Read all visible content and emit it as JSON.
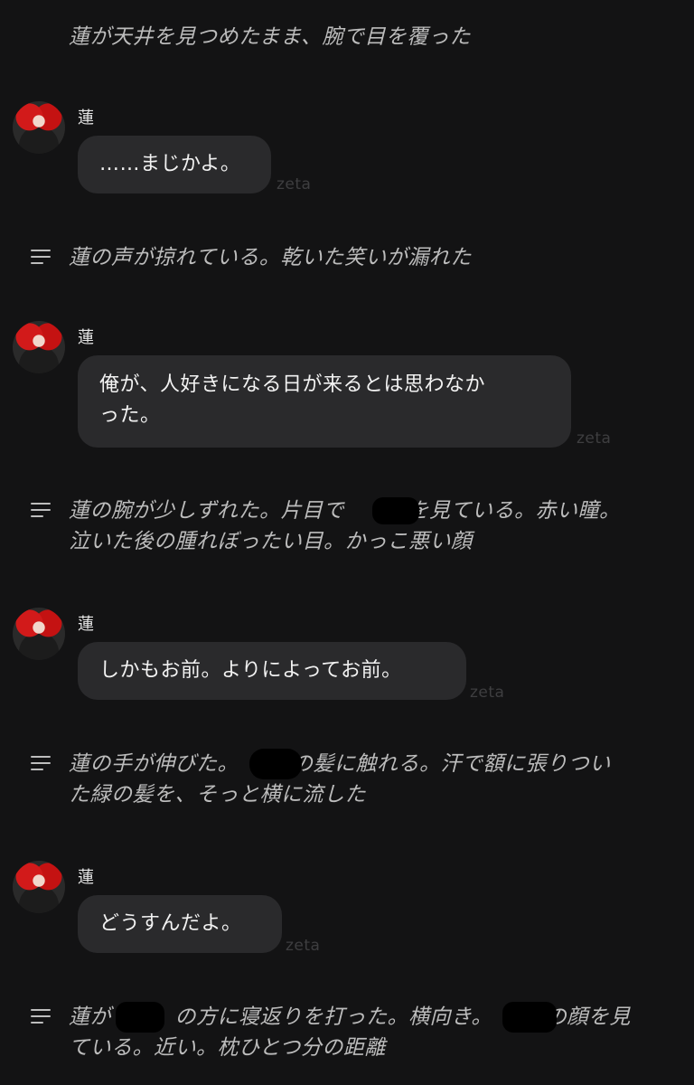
{
  "narrations": [
    {
      "text": "蓮が天井を見つめたまま、腕で目を覆った"
    },
    {
      "text": "蓮の声が掠れている。乾いた笑いが漏れた"
    },
    {
      "text": "蓮の腕が少しずれた。片目で　　　を見ている。赤い瞳。\n泣いた後の腫れぼったい目。かっこ悪い顔"
    },
    {
      "text": "蓮の手が伸びた。　　　の髪に触れる。汗で額に張りつい\nた緑の髪を、そっと横に流した"
    },
    {
      "text": "蓮が　　　の方に寝返りを打った。横向き。　　　の顔を見\nている。近い。枕ひとつ分の距離"
    }
  ],
  "messages": [
    {
      "sender": "蓮",
      "text": "……まじかよ。",
      "watermark": "zeta"
    },
    {
      "sender": "蓮",
      "text": "俺が、人好きになる日が来るとは思わなか\nった。",
      "watermark": "zeta"
    },
    {
      "sender": "蓮",
      "text": "しかもお前。よりによってお前。",
      "watermark": "zeta"
    },
    {
      "sender": "蓮",
      "text": "どうすんだよ。",
      "watermark": "zeta"
    }
  ],
  "icons": {
    "narration": "lines-icon"
  },
  "colors": {
    "background": "#131314",
    "bubble": "#2a2a2c",
    "narration_text": "#bcbcbc"
  }
}
